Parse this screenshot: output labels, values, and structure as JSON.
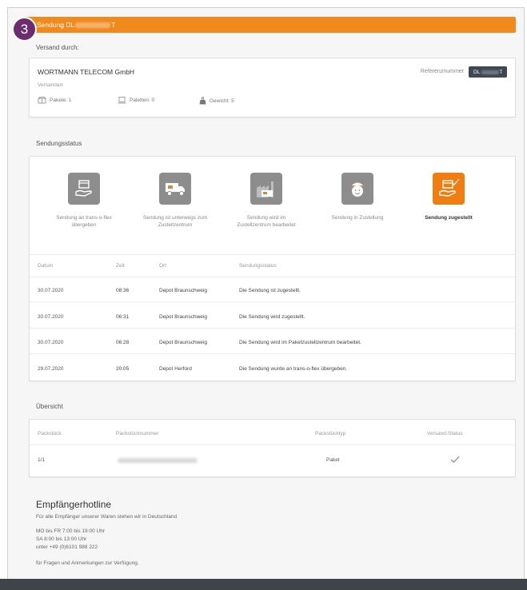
{
  "step_badge": "3",
  "header": {
    "title_prefix": "Sendung DL",
    "title_suffix": "T"
  },
  "shipper": {
    "section_label": "Versand durch:",
    "company": "WORTMANN TELECOM GmbH",
    "reference_label": "Referenznummer",
    "reference_prefix": "DL",
    "reference_suffix": "T",
    "shipping_type_label": "Versandart",
    "packages_label": "Pakete: 1",
    "pallets_label": "Paletten: 0",
    "weight_label": "Gewicht: 5"
  },
  "status": {
    "section_label": "Sendungsstatus",
    "steps": [
      {
        "line1": "Sendung an trans-o-flex",
        "line2": "übergeben",
        "icon": "hand-package-icon",
        "active": false
      },
      {
        "line1": "Sendung ist unterwegs zum",
        "line2": "Zustellzentrum",
        "icon": "delivery-truck-icon",
        "active": false
      },
      {
        "line1": "Sendung wird im",
        "line2": "Zustellzentrum bearbeitet",
        "icon": "depot-factory-icon",
        "active": false
      },
      {
        "line1": "Sendung in Zustellung",
        "line2": "",
        "icon": "courier-icon",
        "active": false
      },
      {
        "line1": "Sendung zugestellt",
        "line2": "",
        "icon": "delivered-package-icon",
        "active": true
      }
    ],
    "columns": {
      "date": "Datum",
      "time": "Zeit",
      "place": "Ort",
      "status": "Sendungsstatus"
    },
    "rows": [
      {
        "date": "30.07.2020",
        "time": "08:36",
        "place": "Depot Braunschweig",
        "status": "Die Sendung ist zugestellt."
      },
      {
        "date": "30.07.2020",
        "time": "06:31",
        "place": "Depot Braunschweig",
        "status": "Die Sendung wird zugestellt."
      },
      {
        "date": "30.07.2020",
        "time": "06:28",
        "place": "Depot Braunschweig",
        "status": "Die Sendung wird im Paketzustellzentrum bearbeitet."
      },
      {
        "date": "29.07.2020",
        "time": "20:05",
        "place": "Depot Herford",
        "status": "Die Sendung wurde an trans-o-flex übergeben."
      }
    ],
    "colors": {
      "active": "#ef7d12",
      "inactive": "#8d8d8d"
    }
  },
  "overview": {
    "section_label": "Übersicht",
    "columns": {
      "piece": "Packstück",
      "number": "Packstücknummer",
      "type": "Packstücktyp",
      "status": "Versand-Status"
    },
    "rows": [
      {
        "piece": "1/1",
        "type": "Paket",
        "status_icon": "checkmark-icon"
      }
    ]
  },
  "hotline": {
    "title": "Empfängerhotline",
    "subtitle": "Für alle Empfänger unserer Waren stehen wir in Deutschland",
    "hours1": "MO bis FR 7:00 bis 19:00 Uhr",
    "hours2": "SA 8:00 bis 13:00 Uhr",
    "phone": "unter +49 (0)6101 988 222",
    "note": "für Fragen und Anmerkungen zur Verfügung."
  },
  "brand_color": "#f08a1c"
}
